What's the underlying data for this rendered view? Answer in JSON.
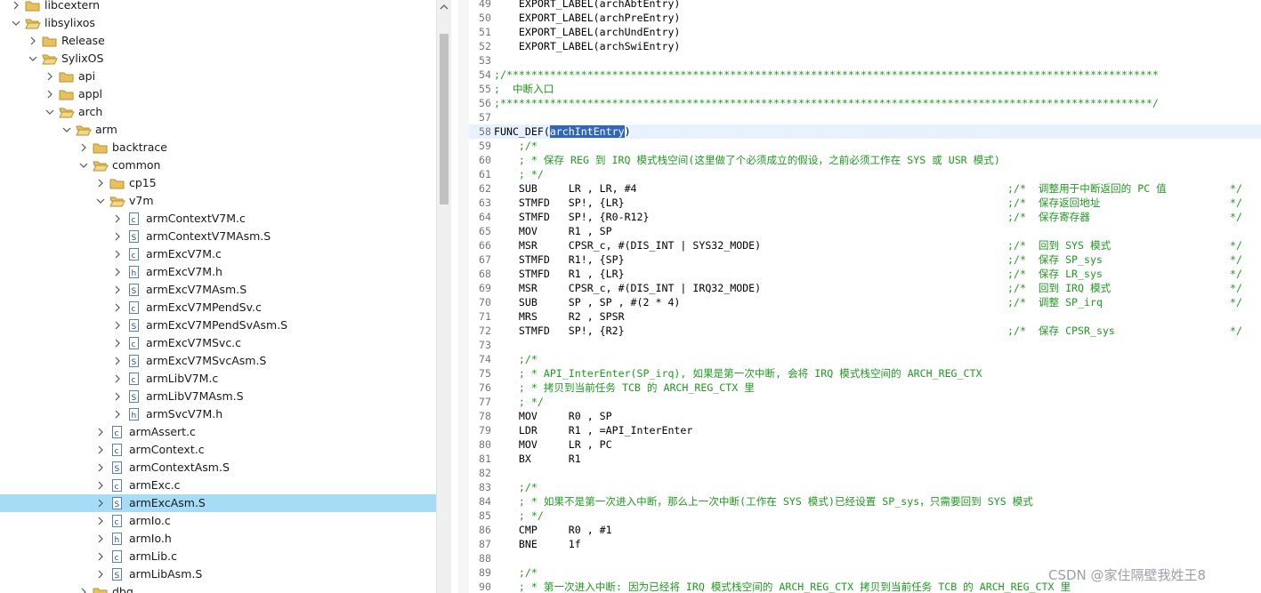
{
  "tree": {
    "items": [
      {
        "label": "libcextern",
        "depth": 0,
        "icon": "folder-closed-icon",
        "arrow": "expand"
      },
      {
        "label": "libsylixos",
        "depth": 0,
        "icon": "folder-open-icon",
        "arrow": "collapse"
      },
      {
        "label": "Release",
        "depth": 1,
        "icon": "folder-closed-icon",
        "arrow": "expand"
      },
      {
        "label": "SylixOS",
        "depth": 1,
        "icon": "folder-open-icon",
        "arrow": "collapse"
      },
      {
        "label": "api",
        "depth": 2,
        "icon": "folder-closed-icon",
        "arrow": "expand"
      },
      {
        "label": "appl",
        "depth": 2,
        "icon": "folder-closed-icon",
        "arrow": "expand"
      },
      {
        "label": "arch",
        "depth": 2,
        "icon": "folder-open-icon",
        "arrow": "collapse"
      },
      {
        "label": "arm",
        "depth": 3,
        "icon": "folder-open-icon",
        "arrow": "collapse"
      },
      {
        "label": "backtrace",
        "depth": 4,
        "icon": "folder-closed-icon",
        "arrow": "expand"
      },
      {
        "label": "common",
        "depth": 4,
        "icon": "folder-open-icon",
        "arrow": "collapse"
      },
      {
        "label": "cp15",
        "depth": 5,
        "icon": "folder-closed-icon",
        "arrow": "expand"
      },
      {
        "label": "v7m",
        "depth": 5,
        "icon": "folder-open-icon",
        "arrow": "collapse"
      },
      {
        "label": "armContextV7M.c",
        "depth": 6,
        "icon": "c-file-icon",
        "arrow": "expand"
      },
      {
        "label": "armContextV7MAsm.S",
        "depth": 6,
        "icon": "s-file-icon",
        "arrow": "expand"
      },
      {
        "label": "armExcV7M.c",
        "depth": 6,
        "icon": "c-file-icon",
        "arrow": "expand"
      },
      {
        "label": "armExcV7M.h",
        "depth": 6,
        "icon": "h-file-icon",
        "arrow": "expand"
      },
      {
        "label": "armExcV7MAsm.S",
        "depth": 6,
        "icon": "s-file-icon",
        "arrow": "expand"
      },
      {
        "label": "armExcV7MPendSv.c",
        "depth": 6,
        "icon": "c-file-icon",
        "arrow": "expand"
      },
      {
        "label": "armExcV7MPendSvAsm.S",
        "depth": 6,
        "icon": "s-file-icon",
        "arrow": "expand"
      },
      {
        "label": "armExcV7MSvc.c",
        "depth": 6,
        "icon": "c-file-icon",
        "arrow": "expand"
      },
      {
        "label": "armExcV7MSvcAsm.S",
        "depth": 6,
        "icon": "s-file-icon",
        "arrow": "expand"
      },
      {
        "label": "armLibV7M.c",
        "depth": 6,
        "icon": "c-file-icon",
        "arrow": "expand"
      },
      {
        "label": "armLibV7MAsm.S",
        "depth": 6,
        "icon": "s-file-icon",
        "arrow": "expand"
      },
      {
        "label": "armSvcV7M.h",
        "depth": 6,
        "icon": "h-file-icon",
        "arrow": "expand"
      },
      {
        "label": "armAssert.c",
        "depth": 5,
        "icon": "c-file-icon",
        "arrow": "expand"
      },
      {
        "label": "armContext.c",
        "depth": 5,
        "icon": "c-file-icon",
        "arrow": "expand"
      },
      {
        "label": "armContextAsm.S",
        "depth": 5,
        "icon": "s-file-icon",
        "arrow": "expand"
      },
      {
        "label": "armExc.c",
        "depth": 5,
        "icon": "c-file-icon",
        "arrow": "expand"
      },
      {
        "label": "armExcAsm.S",
        "depth": 5,
        "icon": "s-file-icon",
        "arrow": "expand",
        "selected": true
      },
      {
        "label": "armIo.c",
        "depth": 5,
        "icon": "c-file-icon",
        "arrow": "expand"
      },
      {
        "label": "armIo.h",
        "depth": 5,
        "icon": "h-file-icon",
        "arrow": "expand"
      },
      {
        "label": "armLib.c",
        "depth": 5,
        "icon": "c-file-icon",
        "arrow": "expand"
      },
      {
        "label": "armLibAsm.S",
        "depth": 5,
        "icon": "s-file-icon",
        "arrow": "expand"
      },
      {
        "label": "dbg",
        "depth": 4,
        "icon": "folder-closed-icon",
        "arrow": "expand"
      }
    ]
  },
  "editor": {
    "lines": [
      {
        "n": "49",
        "parts": [
          {
            "t": "    EXPORT_LABEL(archAbtEntry)"
          }
        ]
      },
      {
        "n": "50",
        "parts": [
          {
            "t": "    EXPORT_LABEL(archPreEntry)"
          }
        ]
      },
      {
        "n": "51",
        "parts": [
          {
            "t": "    EXPORT_LABEL(archUndEntry)"
          }
        ]
      },
      {
        "n": "52",
        "parts": [
          {
            "t": "    EXPORT_LABEL(archSwiEntry)"
          }
        ]
      },
      {
        "n": "53",
        "parts": []
      },
      {
        "n": "54",
        "parts": [
          {
            "t": ";/*********************************************************************************************************",
            "cls": "c"
          }
        ]
      },
      {
        "n": "55",
        "parts": [
          {
            "t": ";  中断入口",
            "cls": "c"
          }
        ]
      },
      {
        "n": "56",
        "parts": [
          {
            "t": ";*********************************************************************************************************/",
            "cls": "c"
          }
        ]
      },
      {
        "n": "57",
        "parts": []
      },
      {
        "n": "58",
        "cur": true,
        "parts": [
          {
            "t": "FUNC_DEF("
          },
          {
            "t": "archIntEntry",
            "cls": "hl"
          },
          {
            "t": ")"
          }
        ]
      },
      {
        "n": "59",
        "parts": [
          {
            "t": "    ;/*",
            "cls": "c"
          }
        ]
      },
      {
        "n": "60",
        "parts": [
          {
            "t": "    ; * 保存 REG 到 IRQ 模式栈空间(这里做了个必须成立的假设，之前必须工作在 SYS 或 USR 模式)",
            "cls": "c"
          }
        ]
      },
      {
        "n": "61",
        "parts": [
          {
            "t": "    ; */",
            "cls": "c"
          }
        ]
      },
      {
        "n": "62",
        "parts": [
          {
            "t": "    SUB     LR , LR, #4"
          }
        ],
        "ann": ";/*  调整用于中断返回的 PC 值",
        "end": "*/"
      },
      {
        "n": "63",
        "parts": [
          {
            "t": "    STMFD   SP!, {LR}"
          }
        ],
        "ann": ";/*  保存返回地址",
        "end": "*/"
      },
      {
        "n": "64",
        "parts": [
          {
            "t": "    STMFD   SP!, {R0-R12}"
          }
        ],
        "ann": ";/*  保存寄存器",
        "end": "*/"
      },
      {
        "n": "65",
        "parts": [
          {
            "t": "    MOV     R1 , SP"
          }
        ]
      },
      {
        "n": "66",
        "parts": [
          {
            "t": "    MSR     CPSR_c, #(DIS_INT | SYS32_MODE)"
          }
        ],
        "ann": ";/*  回到 SYS 模式",
        "end": "*/"
      },
      {
        "n": "67",
        "parts": [
          {
            "t": "    STMFD   R1!, {SP}"
          }
        ],
        "ann": ";/*  保存 SP_sys",
        "end": "*/"
      },
      {
        "n": "68",
        "parts": [
          {
            "t": "    STMFD   R1 , {LR}"
          }
        ],
        "ann": ";/*  保存 LR_sys",
        "end": "*/"
      },
      {
        "n": "69",
        "parts": [
          {
            "t": "    MSR     CPSR_c, #(DIS_INT | IRQ32_MODE)"
          }
        ],
        "ann": ";/*  回到 IRQ 模式",
        "end": "*/"
      },
      {
        "n": "70",
        "parts": [
          {
            "t": "    SUB     SP , SP , #(2 * 4)"
          }
        ],
        "ann": ";/*  调整 SP_irq",
        "end": "*/"
      },
      {
        "n": "71",
        "parts": [
          {
            "t": "    MRS     R2 , SPSR"
          }
        ]
      },
      {
        "n": "72",
        "parts": [
          {
            "t": "    STMFD   SP!, {R2}"
          }
        ],
        "ann": ";/*  保存 CPSR_sys",
        "end": "*/"
      },
      {
        "n": "73",
        "parts": []
      },
      {
        "n": "74",
        "parts": [
          {
            "t": "    ;/*",
            "cls": "c"
          }
        ]
      },
      {
        "n": "75",
        "parts": [
          {
            "t": "    ; * API_InterEnter(SP_irq), 如果是第一次中断, 会将 IRQ 模式栈空间的 ARCH_REG_CTX",
            "cls": "c"
          }
        ]
      },
      {
        "n": "76",
        "parts": [
          {
            "t": "    ; * 拷贝到当前任务 TCB 的 ARCH_REG_CTX 里",
            "cls": "c"
          }
        ]
      },
      {
        "n": "77",
        "parts": [
          {
            "t": "    ; */",
            "cls": "c"
          }
        ]
      },
      {
        "n": "78",
        "parts": [
          {
            "t": "    MOV     R0 , SP"
          }
        ]
      },
      {
        "n": "79",
        "parts": [
          {
            "t": "    LDR     R1 , =API_InterEnter"
          }
        ]
      },
      {
        "n": "80",
        "parts": [
          {
            "t": "    MOV     LR , PC"
          }
        ]
      },
      {
        "n": "81",
        "parts": [
          {
            "t": "    BX      R1"
          }
        ]
      },
      {
        "n": "82",
        "parts": []
      },
      {
        "n": "83",
        "parts": [
          {
            "t": "    ;/*",
            "cls": "c"
          }
        ]
      },
      {
        "n": "84",
        "parts": [
          {
            "t": "    ; * 如果不是第一次进入中断，那么上一次中断(工作在 SYS 模式)已经设置 SP_sys，只需要回到 SYS 模式",
            "cls": "c"
          }
        ]
      },
      {
        "n": "85",
        "parts": [
          {
            "t": "    ; */",
            "cls": "c"
          }
        ]
      },
      {
        "n": "86",
        "parts": [
          {
            "t": "    CMP     R0 , #1"
          }
        ]
      },
      {
        "n": "87",
        "parts": [
          {
            "t": "    BNE     1f"
          }
        ]
      },
      {
        "n": "88",
        "parts": []
      },
      {
        "n": "89",
        "parts": [
          {
            "t": "    ;/*",
            "cls": "c"
          }
        ]
      },
      {
        "n": "90",
        "parts": [
          {
            "t": "    ; * 第一次进入中断: 因为已经将 IRQ 模式栈空间的 ARCH_REG_CTX 拷贝到当前任务 TCB 的 ARCH_REG_CTX 里",
            "cls": "c"
          }
        ]
      }
    ]
  },
  "watermark": "CSDN @家住隔壁我姓王8"
}
